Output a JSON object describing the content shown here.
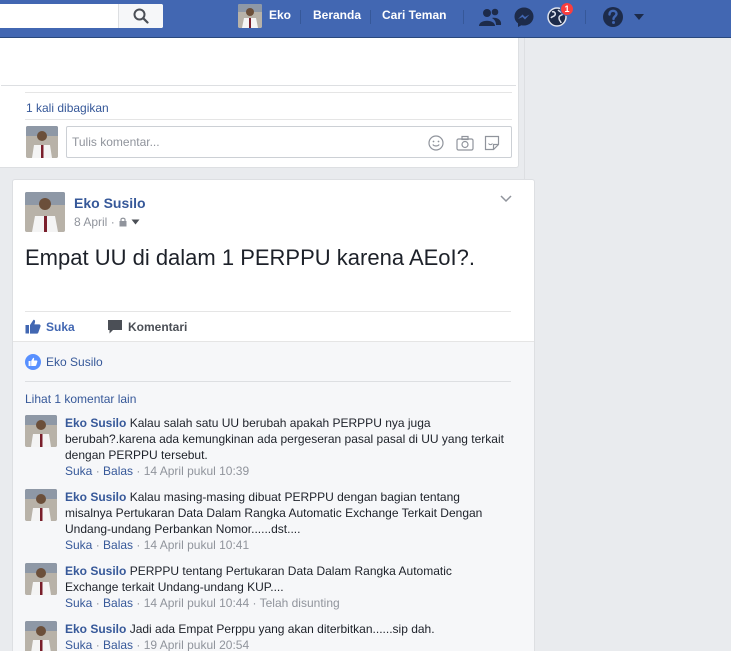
{
  "topbar": {
    "user_name": "Eko",
    "home_label": "Beranda",
    "find_friends_label": "Cari Teman",
    "notification_count": "1"
  },
  "previous_post": {
    "shares_text": "1 kali dibagikan",
    "comment_placeholder": "Tulis komentar..."
  },
  "post": {
    "author": "Eko Susilo",
    "date": "8 April",
    "date_sep": " · ",
    "text": "Empat UU di dalam 1 PERPPU karena AEoI?.",
    "like_label": "Suka",
    "comment_label": "Komentari",
    "liked_by": "Eko Susilo",
    "more_comments": "Lihat 1 komentar lain"
  },
  "comments": [
    {
      "author": "Eko Susilo",
      "text": "Kalau salah satu UU berubah apakah PERPPU nya juga berubah?.karena ada kemungkinan ada pergeseran pasal pasal di UU yang terkait dengan PERPPU tersebut.",
      "like": "Suka",
      "reply": "Balas",
      "time": "14 April pukul 10:39",
      "edited": ""
    },
    {
      "author": "Eko Susilo",
      "text": "Kalau masing-masing dibuat PERPPU dengan bagian tentang misalnya Pertukaran Data Dalam Rangka Automatic Exchange Terkait Dengan Undang-undang Perbankan Nomor......dst....",
      "like": "Suka",
      "reply": "Balas",
      "time": "14 April pukul 10:41",
      "edited": ""
    },
    {
      "author": "Eko Susilo",
      "text": "PERPPU tentang Pertukaran Data Dalam Rangka Automatic Exchange terkait Undang-undang KUP....",
      "like": "Suka",
      "reply": "Balas",
      "time": "14 April pukul 10:44",
      "edited": "Telah disunting"
    },
    {
      "author": "Eko Susilo",
      "text": "Jadi ada Empat Perppu yang akan diterbitkan......sip dah.",
      "like": "Suka",
      "reply": "Balas",
      "time": "19 April pukul 20:54",
      "edited": ""
    }
  ],
  "icons": {
    "search": "search-icon",
    "friends": "friend-requests-icon",
    "messenger": "messenger-icon",
    "notifications": "globe-icon",
    "help": "help-icon",
    "dropdown": "caret-down-icon"
  },
  "colors": {
    "brand_blue": "#4267b2",
    "link_blue": "#365899",
    "badge_red": "#fa3e3e",
    "muted": "#90949c"
  }
}
